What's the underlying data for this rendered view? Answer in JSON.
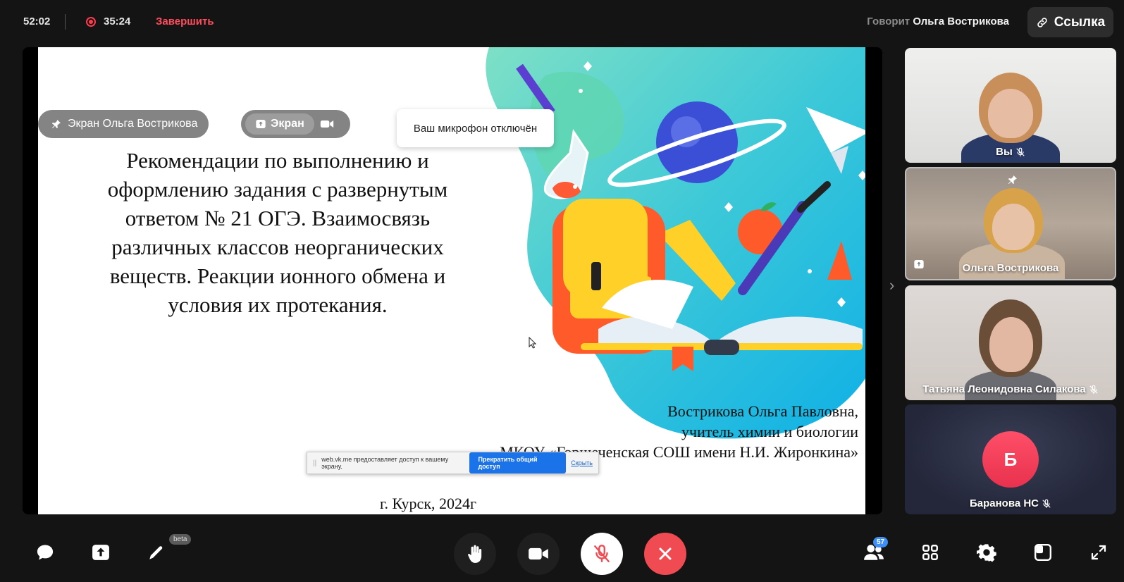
{
  "topbar": {
    "call_timer": "52:02",
    "record_timer": "35:24",
    "finish_label": "Завершить",
    "speaking_prefix": "Говорит",
    "speaking_name": "Ольга Вострикова",
    "link_label": "Ссылка"
  },
  "stage": {
    "pin_label": "Экран Ольга Вострикова",
    "screen_label": "Экран",
    "toast": "Ваш микрофон отключён",
    "slide": {
      "title": "Рекомендации по выполнению и оформлению задания с развернутым ответом № 21 ОГЭ. Взаимосвязь различных классов неорганических веществ. Реакции ионного обмена и условия их протекания.",
      "author_line1": "Вострикова Ольга Павловна,",
      "author_line2": "учитель химии и биологии",
      "author_line3": "МКОУ «Горшеченская СОШ имени Н.И. Жиронкина»",
      "city": "г. Курск, 2024г"
    },
    "share_bar": {
      "text": "web.vk.me предоставляет доступ к вашему экрану.",
      "stop_label": "Прекратить общий доступ",
      "hide_label": "Скрыть"
    }
  },
  "participants": [
    {
      "name": "Вы",
      "muted": true
    },
    {
      "name": "Ольга Вострикова",
      "muted": false,
      "pinned": true,
      "sharing": true
    },
    {
      "name": "Татьяна Леонидовна Силакова",
      "muted": true
    },
    {
      "name": "Баранова НС",
      "muted": true,
      "avatar_letter": "Б"
    }
  ],
  "bottombar": {
    "beta_label": "beta",
    "participants_count": "57"
  },
  "colors": {
    "accent_red": "#ff4d5c",
    "end_call": "#f04a52",
    "badge_blue": "#3d8ef5"
  }
}
